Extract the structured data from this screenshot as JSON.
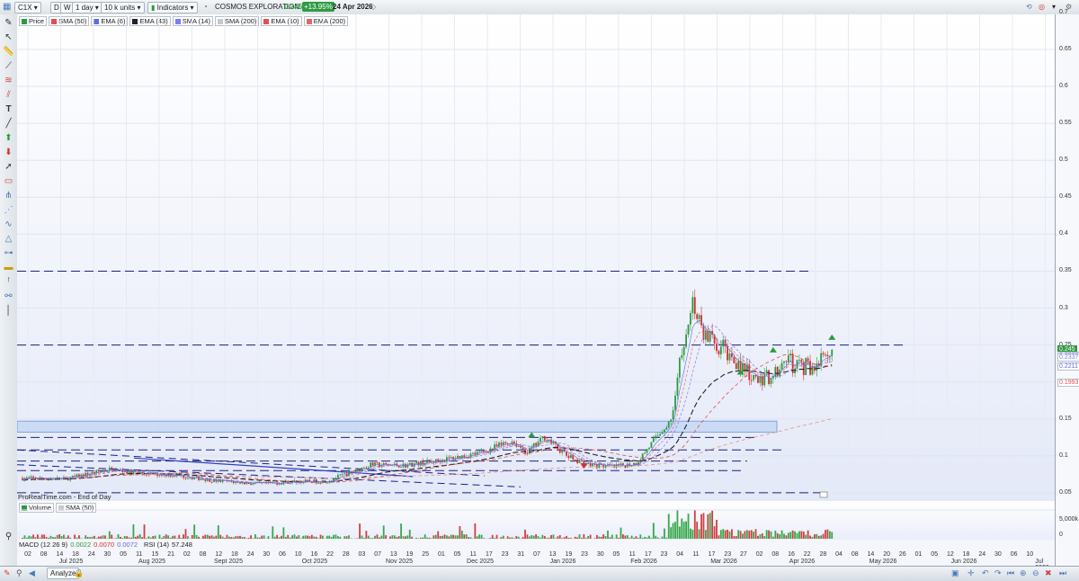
{
  "toolbar": {
    "symbol": "C1X",
    "btn_d": "D",
    "btn_w": "W",
    "interval": "1 day",
    "units": "10 k units",
    "indicators": "Indicators",
    "company": "COSMOS EXPLORATION",
    "price": "0.245",
    "change": "+13.95%",
    "date": "24 Apr 2026"
  },
  "legend": [
    {
      "label": "Price",
      "color": "#2c9a3f"
    },
    {
      "label": "SMA (50)",
      "color": "#e05050"
    },
    {
      "label": "EMA (6)",
      "color": "#5a6ee0"
    },
    {
      "label": "EMA (43)",
      "color": "#222222"
    },
    {
      "label": "SMA (14)",
      "color": "#7a7ef0"
    },
    {
      "label": "SMA (200)",
      "color": "#c8c8c8"
    },
    {
      "label": "EMA (10)",
      "color": "#e05050"
    },
    {
      "label": "EMA (200)",
      "color": "#e06666"
    }
  ],
  "source_label": "ProRealTime.com - End of Day",
  "volume_legend": [
    {
      "label": "Volume",
      "color": "#2c9a3f"
    },
    {
      "label": "SMA (50)",
      "color": "#c8c8c8"
    }
  ],
  "indicator_bar": {
    "macd_label": "MACD (12 26 9)",
    "macd_v1": "0.0022",
    "macd_v2": "0.0070",
    "macd_v3": "0.0072",
    "rsi_label": "RSI (14)",
    "rsi_value": "57.248"
  },
  "price_axis": [
    "0.7",
    "0.65",
    "0.6",
    "0.55",
    "0.5",
    "0.45",
    "0.4",
    "0.35",
    "0.3",
    "0.25",
    "0.2",
    "0.15",
    "0.1",
    "0.05"
  ],
  "price_labels": [
    {
      "text": "0.245",
      "bg": "#2c9a3f",
      "fg": "#ffffff"
    },
    {
      "text": "0.2366",
      "bg": "#ffffff",
      "fg": "#5a6ee0"
    },
    {
      "text": "0.2337",
      "bg": "#ffffff",
      "fg": "#7a7ef0"
    },
    {
      "text": "0.2211",
      "bg": "#ffffff",
      "fg": "#5a6ee0"
    },
    {
      "text": "0.1993",
      "bg": "#ffffff",
      "fg": "#e05050"
    }
  ],
  "volume_axis": [
    "5,000k",
    "0"
  ],
  "x_days": [
    "02",
    "08",
    "14",
    "18",
    "24",
    "30",
    "05",
    "11",
    "15",
    "21",
    "02",
    "08",
    "12",
    "18",
    "24",
    "30",
    "06",
    "10",
    "16",
    "22",
    "28",
    "03",
    "07",
    "13",
    "19",
    "25",
    "01",
    "05",
    "11",
    "17",
    "23",
    "31",
    "07",
    "13",
    "19",
    "23",
    "30",
    "05",
    "11",
    "17",
    "23",
    "04",
    "11",
    "17",
    "23",
    "27",
    "02",
    "08",
    "16",
    "22",
    "28",
    "04",
    "08",
    "14",
    "20",
    "26",
    "01",
    "05",
    "12",
    "18",
    "24",
    "30",
    "06",
    "10"
  ],
  "x_months": [
    "Jul 2025",
    "Aug 2025",
    "Sept 2025",
    "Oct 2025",
    "Nov 2025",
    "Dec 2025",
    "Jan 2026",
    "Feb 2026",
    "Mar 2026",
    "Apr 2026",
    "May 2026",
    "Jun 2026",
    "Jul 2026"
  ],
  "bottom": {
    "analyze": "Analyze"
  },
  "chart_data": {
    "type": "candlestick",
    "instrument": "COSMOS EXPLORATION (C1X)",
    "interval": "1 day",
    "ylim": [
      0.04,
      0.71
    ],
    "last_close": 0.245,
    "horizontal_levels": [
      0.35,
      0.25,
      0.125,
      0.108,
      0.093,
      0.08,
      0.05
    ],
    "zone": [
      0.132,
      0.147
    ],
    "close_series": [
      {
        "period": "Jul 2025",
        "close": 0.068
      },
      {
        "period": "Aug 2025",
        "close": 0.085
      },
      {
        "period": "Sept 2025",
        "close": 0.074
      },
      {
        "period": "Oct 2025",
        "close": 0.062
      },
      {
        "period": "Nov 2025",
        "close": 0.088
      },
      {
        "period": "Dec 2025",
        "close": 0.105
      },
      {
        "period": "Jan 2026",
        "close": 0.095
      },
      {
        "period": "Feb 2026 early",
        "close": 0.09
      },
      {
        "period": "Feb 2026 late",
        "close": 0.32
      },
      {
        "period": "Mar 2026",
        "close": 0.2
      },
      {
        "period": "Apr 2026",
        "close": 0.245
      }
    ]
  }
}
